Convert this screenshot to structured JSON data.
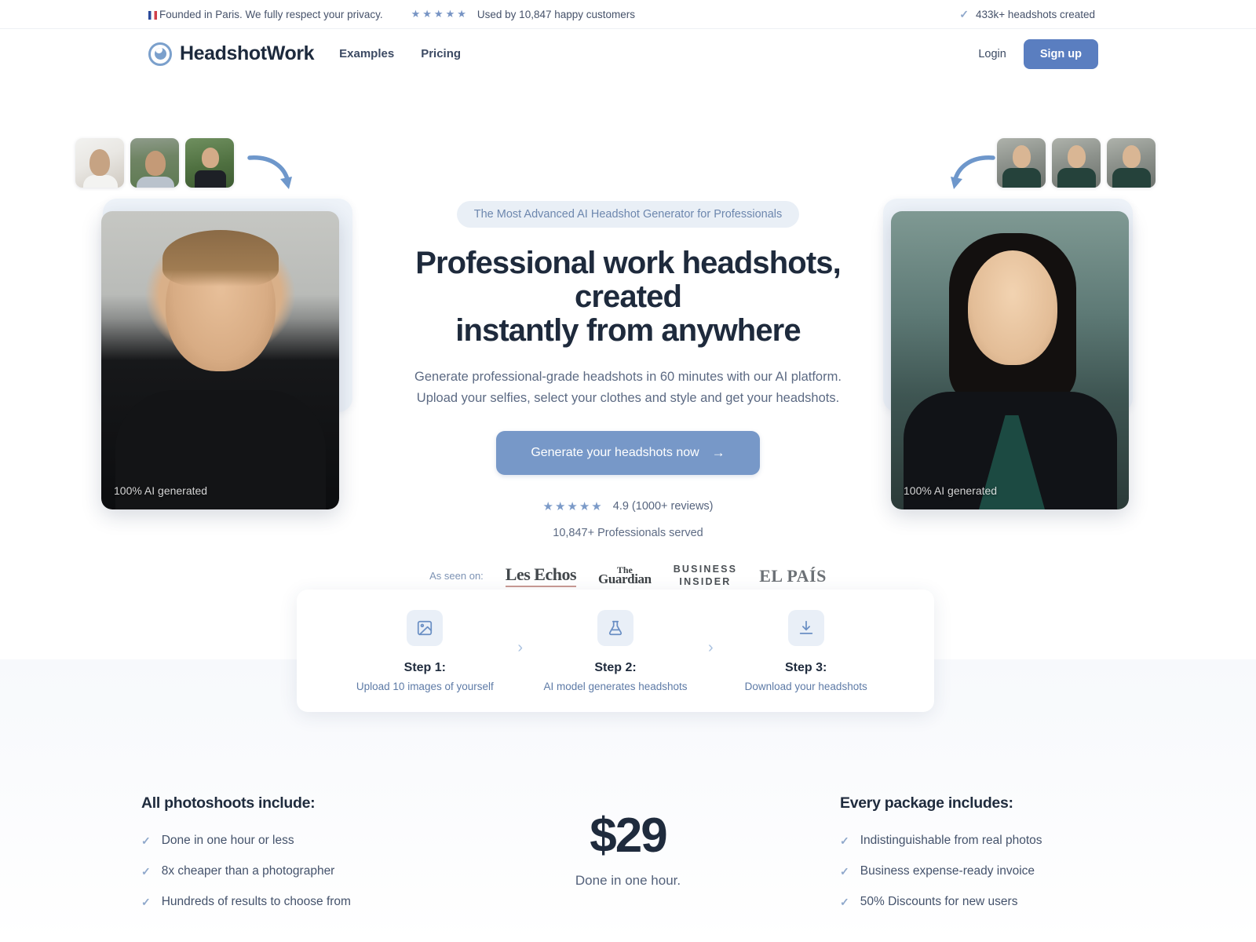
{
  "topbar": {
    "founded_text": "Founded in Paris. We fully respect your privacy.",
    "flag_icon": "france-flag-icon",
    "stars": "★★★★★",
    "customers_text": "Used by 10,847 happy customers",
    "check_icon": "✓",
    "headshots_text": "433k+ headshots created"
  },
  "nav": {
    "brand": "HeadshotWork",
    "logo_icon": "headshotwork-logo-icon",
    "links": [
      {
        "label": "Examples"
      },
      {
        "label": "Pricing"
      }
    ],
    "login_label": "Login",
    "signup_label": "Sign up"
  },
  "hero": {
    "badge": "The Most Advanced AI Headshot Generator for Professionals",
    "heading_line1": "Professional work headshots, created",
    "heading_line2": "instantly from anywhere",
    "sub_line1": "Generate professional-grade headshots in 60 minutes with our AI platform.",
    "sub_line2": "Upload your selfies, select your clothes and style and get your headshots.",
    "cta_label": "Generate your headshots now",
    "cta_arrow": "→",
    "stars": "★★★★★",
    "rating_text": "4.9 (1000+ reviews)",
    "served_text": "10,847+ Professionals served",
    "left_photo_caption": "100% AI generated",
    "right_photo_caption": "100% AI generated",
    "left_arrow_icon": "curved-arrow-down-right-icon",
    "right_arrow_icon": "curved-arrow-down-left-icon",
    "thumbnails_left": [
      {
        "name": "selfie-thumb-1"
      },
      {
        "name": "selfie-thumb-2"
      },
      {
        "name": "selfie-thumb-3"
      }
    ],
    "thumbnails_right": [
      {
        "name": "result-thumb-1"
      },
      {
        "name": "result-thumb-2"
      },
      {
        "name": "result-thumb-3"
      }
    ]
  },
  "press": {
    "label": "As seen on:",
    "logos": [
      {
        "name": "les-echos-logo",
        "text": "Les Echos"
      },
      {
        "name": "the-guardian-logo",
        "line1": "The",
        "line2": "Guardian"
      },
      {
        "name": "business-insider-logo",
        "line1": "BUSINESS",
        "line2": "INSIDER"
      },
      {
        "name": "el-pais-logo",
        "text": "EL PAÍS"
      }
    ]
  },
  "steps": {
    "separator": "›",
    "items": [
      {
        "icon": "image-icon",
        "title": "Step 1:",
        "desc": "Upload 10 images of yourself"
      },
      {
        "icon": "flask-icon",
        "title": "Step 2:",
        "desc": "AI model generates headshots"
      },
      {
        "icon": "download-icon",
        "title": "Step 3:",
        "desc": "Download your headshots"
      }
    ]
  },
  "bottom": {
    "left": {
      "title": "All photoshoots include:",
      "items": [
        "Done in one hour or less",
        "8x cheaper than a photographer",
        "Hundreds of results to choose from"
      ]
    },
    "middle": {
      "price": "$29",
      "caption": "Done in one hour."
    },
    "right": {
      "title": "Every package includes:",
      "items": [
        "Indistinguishable from real photos",
        "Business expense-ready invoice",
        "50% Discounts for new users"
      ]
    },
    "check_icon": "✓"
  },
  "colors": {
    "accent_blue": "#5a7ec0",
    "cta_blue": "#7798c8",
    "badge_bg": "#e9eff6",
    "text_dark": "#1f2b3d",
    "text_muted": "#5c6a83"
  }
}
